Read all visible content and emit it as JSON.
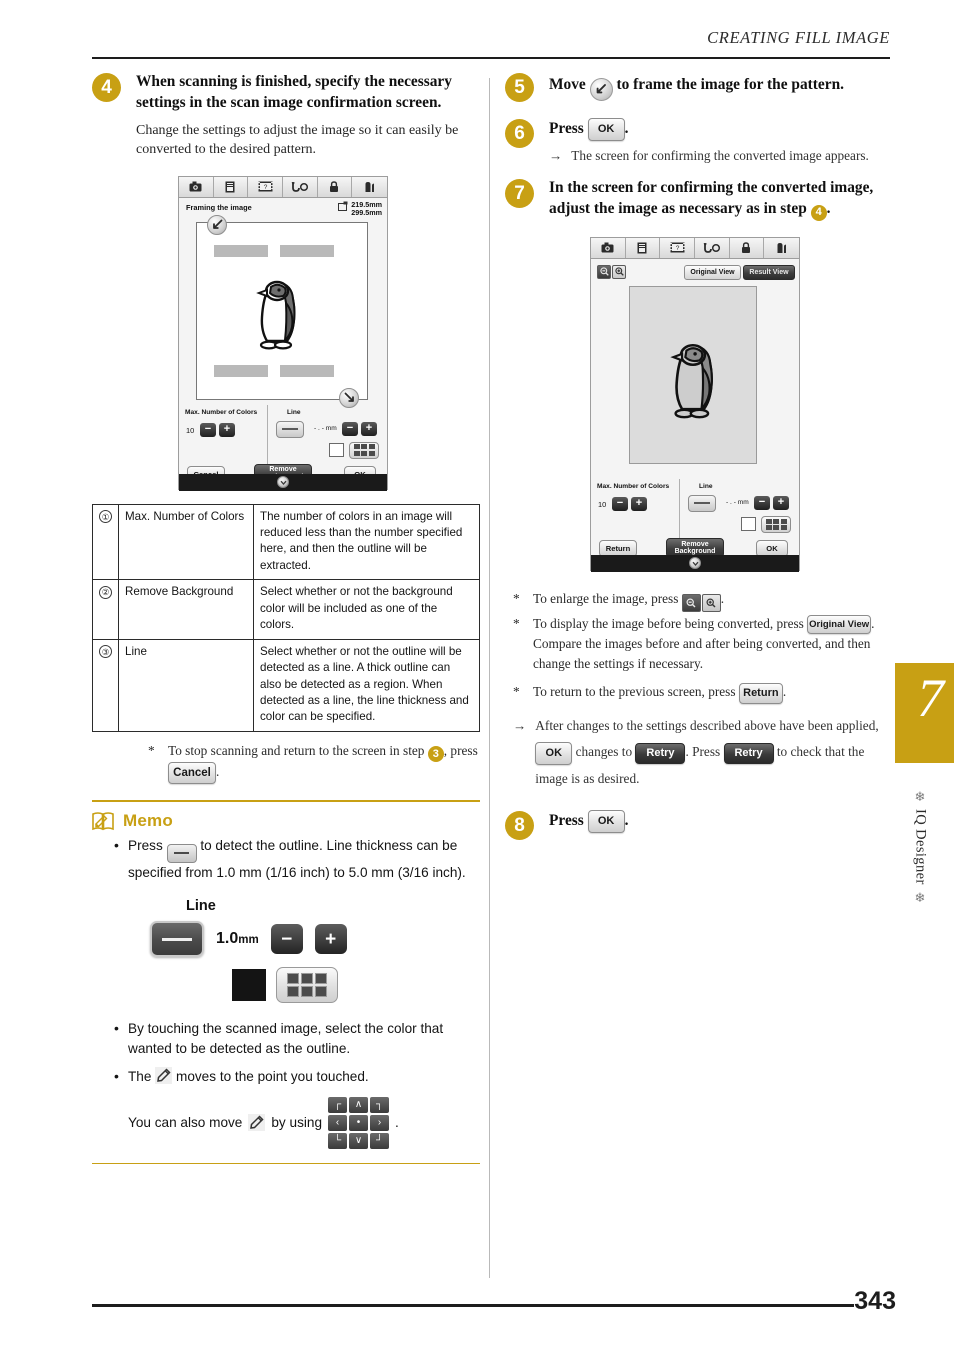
{
  "header": {
    "title": "CREATING FILL IMAGE"
  },
  "footer": {
    "page_number": "343"
  },
  "side_tab": {
    "chapter_number": "7",
    "chapter_label": "IQ Designer",
    "ornament": "❄"
  },
  "left_column": {
    "step4": {
      "number": "4",
      "title": "When scanning is finished, specify the necessary settings in the scan image confirmation screen.",
      "note": "Change the settings to adjust the image so it can easily be converted to the desired pattern."
    },
    "screen1": {
      "title": "Framing the image",
      "dim_width": "219.5mm",
      "dim_height": "299.5mm",
      "max_colors_label": "Max. Number of Colors",
      "max_colors_value": "10",
      "line_label": "Line",
      "line_value": "- . - mm",
      "minus": "−",
      "plus": "+",
      "cancel_label": "Cancel",
      "remove_bg_label": "Remove\nBackground",
      "remove_bg_line1": "Remove",
      "remove_bg_line2": "Background",
      "ok_label": "OK",
      "toolbar_icons": [
        "camera-icon",
        "document-icon",
        "help-icon",
        "needle-thread-icon",
        "lock-icon",
        "home-icon"
      ]
    },
    "table": {
      "rows": [
        {
          "num": "①",
          "name": "Max. Number of Colors",
          "desc": "The number of colors in an image will reduced less than the number specified here, and then the outline will be extracted."
        },
        {
          "num": "②",
          "name": "Remove Background",
          "desc": "Select whether or not the background color will be included as one of the colors."
        },
        {
          "num": "③",
          "name": "Line",
          "desc": "Select whether or not the outline will be detected as a line. A thick outline can also be detected as a region. When detected as a line, the line thickness and color can be specified."
        }
      ]
    },
    "stop_note": {
      "star": "*",
      "text_before": "To stop scanning and return to the screen in step",
      "badge": "3",
      "text_mid": ", press",
      "button": "Cancel",
      "text_after": "."
    },
    "memo": {
      "title": "Memo",
      "icon": "memo-book-icon",
      "bullet1_before": "Press",
      "bullet1_button": "line-button-icon",
      "bullet1_after": "to detect the outline. Line thickness can be specified from 1.0 mm (1/16 inch) to 5.0 mm (3/16 inch).",
      "line_demo": {
        "title": "Line",
        "value": "1.0",
        "unit": "mm",
        "minus": "−",
        "plus": "+"
      },
      "bullet2": "By touching the scanned image, select the color that wanted to be detected as the outline.",
      "bullet3_before": "The",
      "bullet3_mid": "moves to the point you touched.",
      "bullet4_before": "You can also move",
      "bullet4_mid": "by using",
      "bullet4_after": ".",
      "dpad_keys": [
        "┌",
        "∧",
        "┐",
        "‹",
        "•",
        "›",
        "└",
        "∨",
        "┘"
      ]
    }
  },
  "right_column": {
    "step5": {
      "number": "5",
      "text_before": "Move",
      "icon": "move-handle-icon",
      "text_after": "to frame the image for the pattern."
    },
    "step6": {
      "number": "6",
      "text_before": "Press",
      "button": "OK",
      "text_after": ".",
      "arrow": "→",
      "result": "The screen for confirming the converted image appears."
    },
    "step7": {
      "number": "7",
      "text_before": "In the screen for confirming the converted image, adjust the image as necessary as in step",
      "badge": "4",
      "text_after": "."
    },
    "screen2": {
      "original_view_label": "Original View",
      "result_view_label": "Result View",
      "max_colors_label": "Max. Number of Colors",
      "max_colors_value": "10",
      "line_label": "Line",
      "line_value": "- . - mm",
      "minus": "−",
      "plus": "+",
      "return_label": "Return",
      "remove_bg_line1": "Remove",
      "remove_bg_line2": "Background",
      "ok_label": "OK",
      "toolbar_icons": [
        "camera-icon",
        "document-icon",
        "help-icon",
        "needle-thread-icon",
        "lock-icon",
        "home-icon"
      ]
    },
    "notes": {
      "note1_star": "*",
      "note1_before": "To enlarge the image, press",
      "note1_after": ".",
      "note2_star": "*",
      "note2_before": "To display the image before being converted, press",
      "note2_button": "Original View",
      "note2_after": ". Compare the images before and after being converted, and then change the settings if necessary.",
      "note3_star": "*",
      "note3_before": "To return to the previous screen, press",
      "note3_button": "Return",
      "note3_after": ".",
      "note4_arrow": "→",
      "note4_before": "After changes to the settings described above have been applied,",
      "note4_ok": "OK",
      "note4_mid": "changes to",
      "note4_retry": "Retry",
      "note4_mid2": ". Press",
      "note4_retry2": "Retry",
      "note4_after": "to check that the image is as desired."
    },
    "step8": {
      "number": "8",
      "text_before": "Press",
      "button": "OK",
      "text_after": "."
    }
  },
  "colors": {
    "accent_gold": "#C8A014",
    "ink": "#1A1A1A",
    "rule": "#1D1D1D"
  }
}
